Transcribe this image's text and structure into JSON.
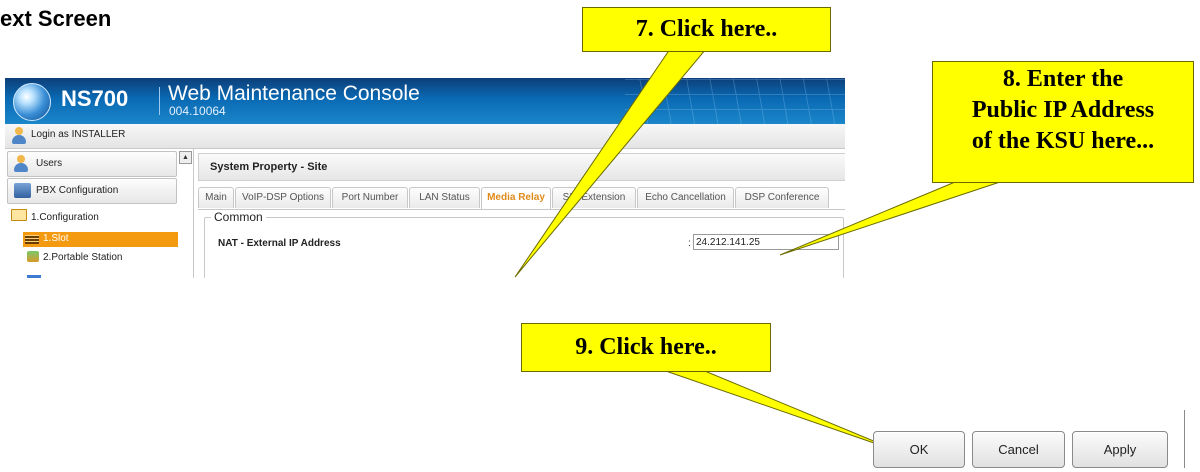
{
  "heading": "ext Screen",
  "console": {
    "model": "NS700",
    "title": "Web Maintenance Console",
    "version": "004.10064",
    "login_text": "Login as INSTALLER",
    "sidebar": {
      "users_label": "Users",
      "pbx_label": "PBX Configuration",
      "folder_label": "1.Configuration",
      "slot_label": "1.Slot",
      "portable_label": "2.Portable Station"
    },
    "property_title": "System Property - Site",
    "tabs": [
      "Main",
      "VoIP-DSP Options",
      "Port Number",
      "LAN Status",
      "Media Relay",
      "SIP Extension",
      "Echo Cancellation",
      "DSP Conference"
    ],
    "active_tab": "Media Relay",
    "section_title": "Common",
    "field_label": "NAT - External IP Address",
    "field_colon": ":",
    "field_value": "24.212.141.25"
  },
  "callouts": {
    "c7": "7. Click here..",
    "c8_line1": "8. Enter the",
    "c8_line2": "Public IP Address",
    "c8_line3": "of the KSU here...",
    "c9": "9. Click here.."
  },
  "buttons": {
    "ok": "OK",
    "cancel": "Cancel",
    "apply": "Apply"
  },
  "colors": {
    "callout": "#ffff00",
    "header_blue": "#0a6ab4",
    "active_tab": "#e08a1a",
    "selected_row": "#f39a10"
  }
}
